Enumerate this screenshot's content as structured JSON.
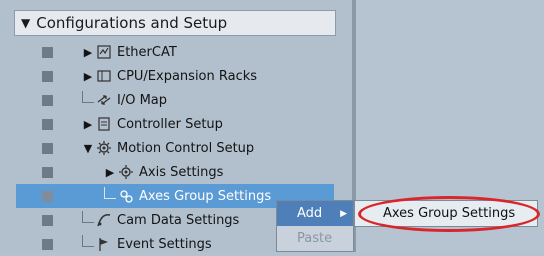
{
  "section": {
    "title": "Configurations and Setup"
  },
  "tree": {
    "items": [
      {
        "label": "EtherCAT"
      },
      {
        "label": "CPU/Expansion Racks"
      },
      {
        "label": "I/O Map"
      },
      {
        "label": "Controller Setup"
      },
      {
        "label": "Motion Control Setup"
      },
      {
        "label": "Axis Settings"
      },
      {
        "label": "Axes Group Settings"
      },
      {
        "label": "Cam Data Settings"
      },
      {
        "label": "Event Settings"
      }
    ]
  },
  "context_menu": {
    "items": [
      {
        "label": "Add"
      },
      {
        "label": "Paste"
      }
    ]
  },
  "submenu": {
    "items": [
      {
        "label": "Axes Group Settings"
      }
    ]
  },
  "colors": {
    "selection": "#5b9bd5",
    "menu_active": "#4f7fb8",
    "annotation": "#d8262a"
  }
}
